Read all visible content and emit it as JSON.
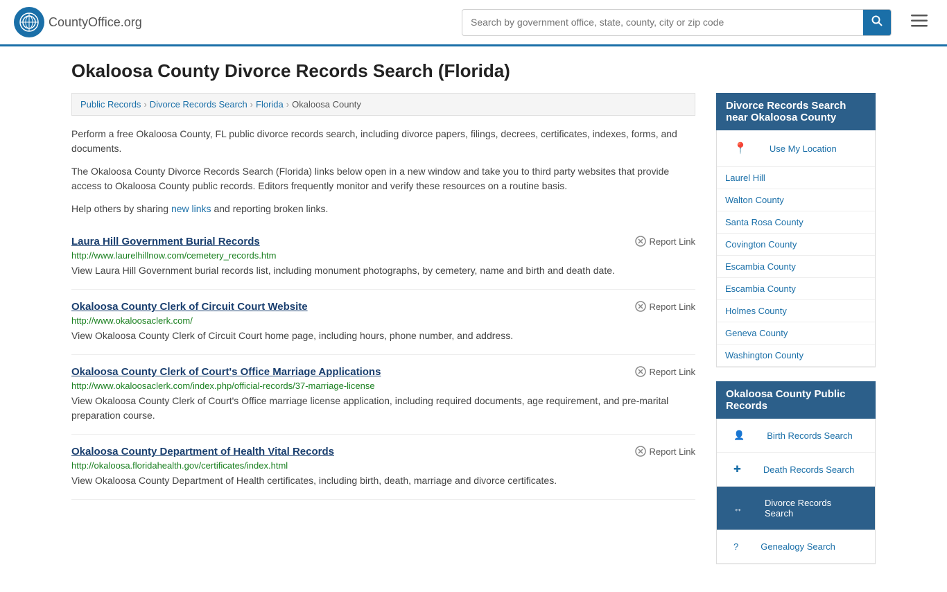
{
  "header": {
    "logo_text": "CountyOffice",
    "logo_suffix": ".org",
    "search_placeholder": "Search by government office, state, county, city or zip code"
  },
  "page": {
    "title": "Okaloosa County Divorce Records Search (Florida)"
  },
  "breadcrumb": {
    "items": [
      {
        "label": "Public Records",
        "href": "#"
      },
      {
        "label": "Divorce Records Search",
        "href": "#"
      },
      {
        "label": "Florida",
        "href": "#"
      },
      {
        "label": "Okaloosa County",
        "href": "#"
      }
    ]
  },
  "description": {
    "para1": "Perform a free Okaloosa County, FL public divorce records search, including divorce papers, filings, decrees, certificates, indexes, forms, and documents.",
    "para2": "The Okaloosa County Divorce Records Search (Florida) links below open in a new window and take you to third party websites that provide access to Okaloosa County public records. Editors frequently monitor and verify these resources on a routine basis.",
    "para3_prefix": "Help others by sharing ",
    "para3_link": "new links",
    "para3_suffix": " and reporting broken links."
  },
  "results": [
    {
      "title": "Laura Hill Government Burial Records",
      "url": "http://www.laurelhillnow.com/cemetery_records.htm",
      "description": "View Laura Hill Government burial records list, including monument photographs, by cemetery, name and birth and death date.",
      "report_label": "Report Link"
    },
    {
      "title": "Okaloosa County Clerk of Circuit Court Website",
      "url": "http://www.okaloosaclerk.com/",
      "description": "View Okaloosa County Clerk of Circuit Court home page, including hours, phone number, and address.",
      "report_label": "Report Link"
    },
    {
      "title": "Okaloosa County Clerk of Court's Office Marriage Applications",
      "url": "http://www.okaloosaclerk.com/index.php/official-records/37-marriage-license",
      "description": "View Okaloosa County Clerk of Court's Office marriage license application, including required documents, age requirement, and pre-marital preparation course.",
      "report_label": "Report Link"
    },
    {
      "title": "Okaloosa County Department of Health Vital Records",
      "url": "http://okaloosa.floridahealth.gov/certificates/index.html",
      "description": "View Okaloosa County Department of Health certificates, including birth, death, marriage and divorce certificates.",
      "report_label": "Report Link"
    }
  ],
  "sidebar": {
    "nearby_title": "Divorce Records Search near Okaloosa County",
    "use_location_label": "Use My Location",
    "nearby_items": [
      {
        "label": "Laurel Hill"
      },
      {
        "label": "Walton County"
      },
      {
        "label": "Santa Rosa County"
      },
      {
        "label": "Covington County"
      },
      {
        "label": "Escambia County"
      },
      {
        "label": "Escambia County"
      },
      {
        "label": "Holmes County"
      },
      {
        "label": "Geneva County"
      },
      {
        "label": "Washington County"
      }
    ],
    "public_records_title": "Okaloosa County Public Records",
    "public_records_items": [
      {
        "label": "Birth Records Search",
        "icon": "👤",
        "active": false
      },
      {
        "label": "Death Records Search",
        "icon": "✚",
        "active": false
      },
      {
        "label": "Divorce Records Search",
        "icon": "↔",
        "active": true
      },
      {
        "label": "Genealogy Search",
        "icon": "?",
        "active": false
      }
    ]
  }
}
